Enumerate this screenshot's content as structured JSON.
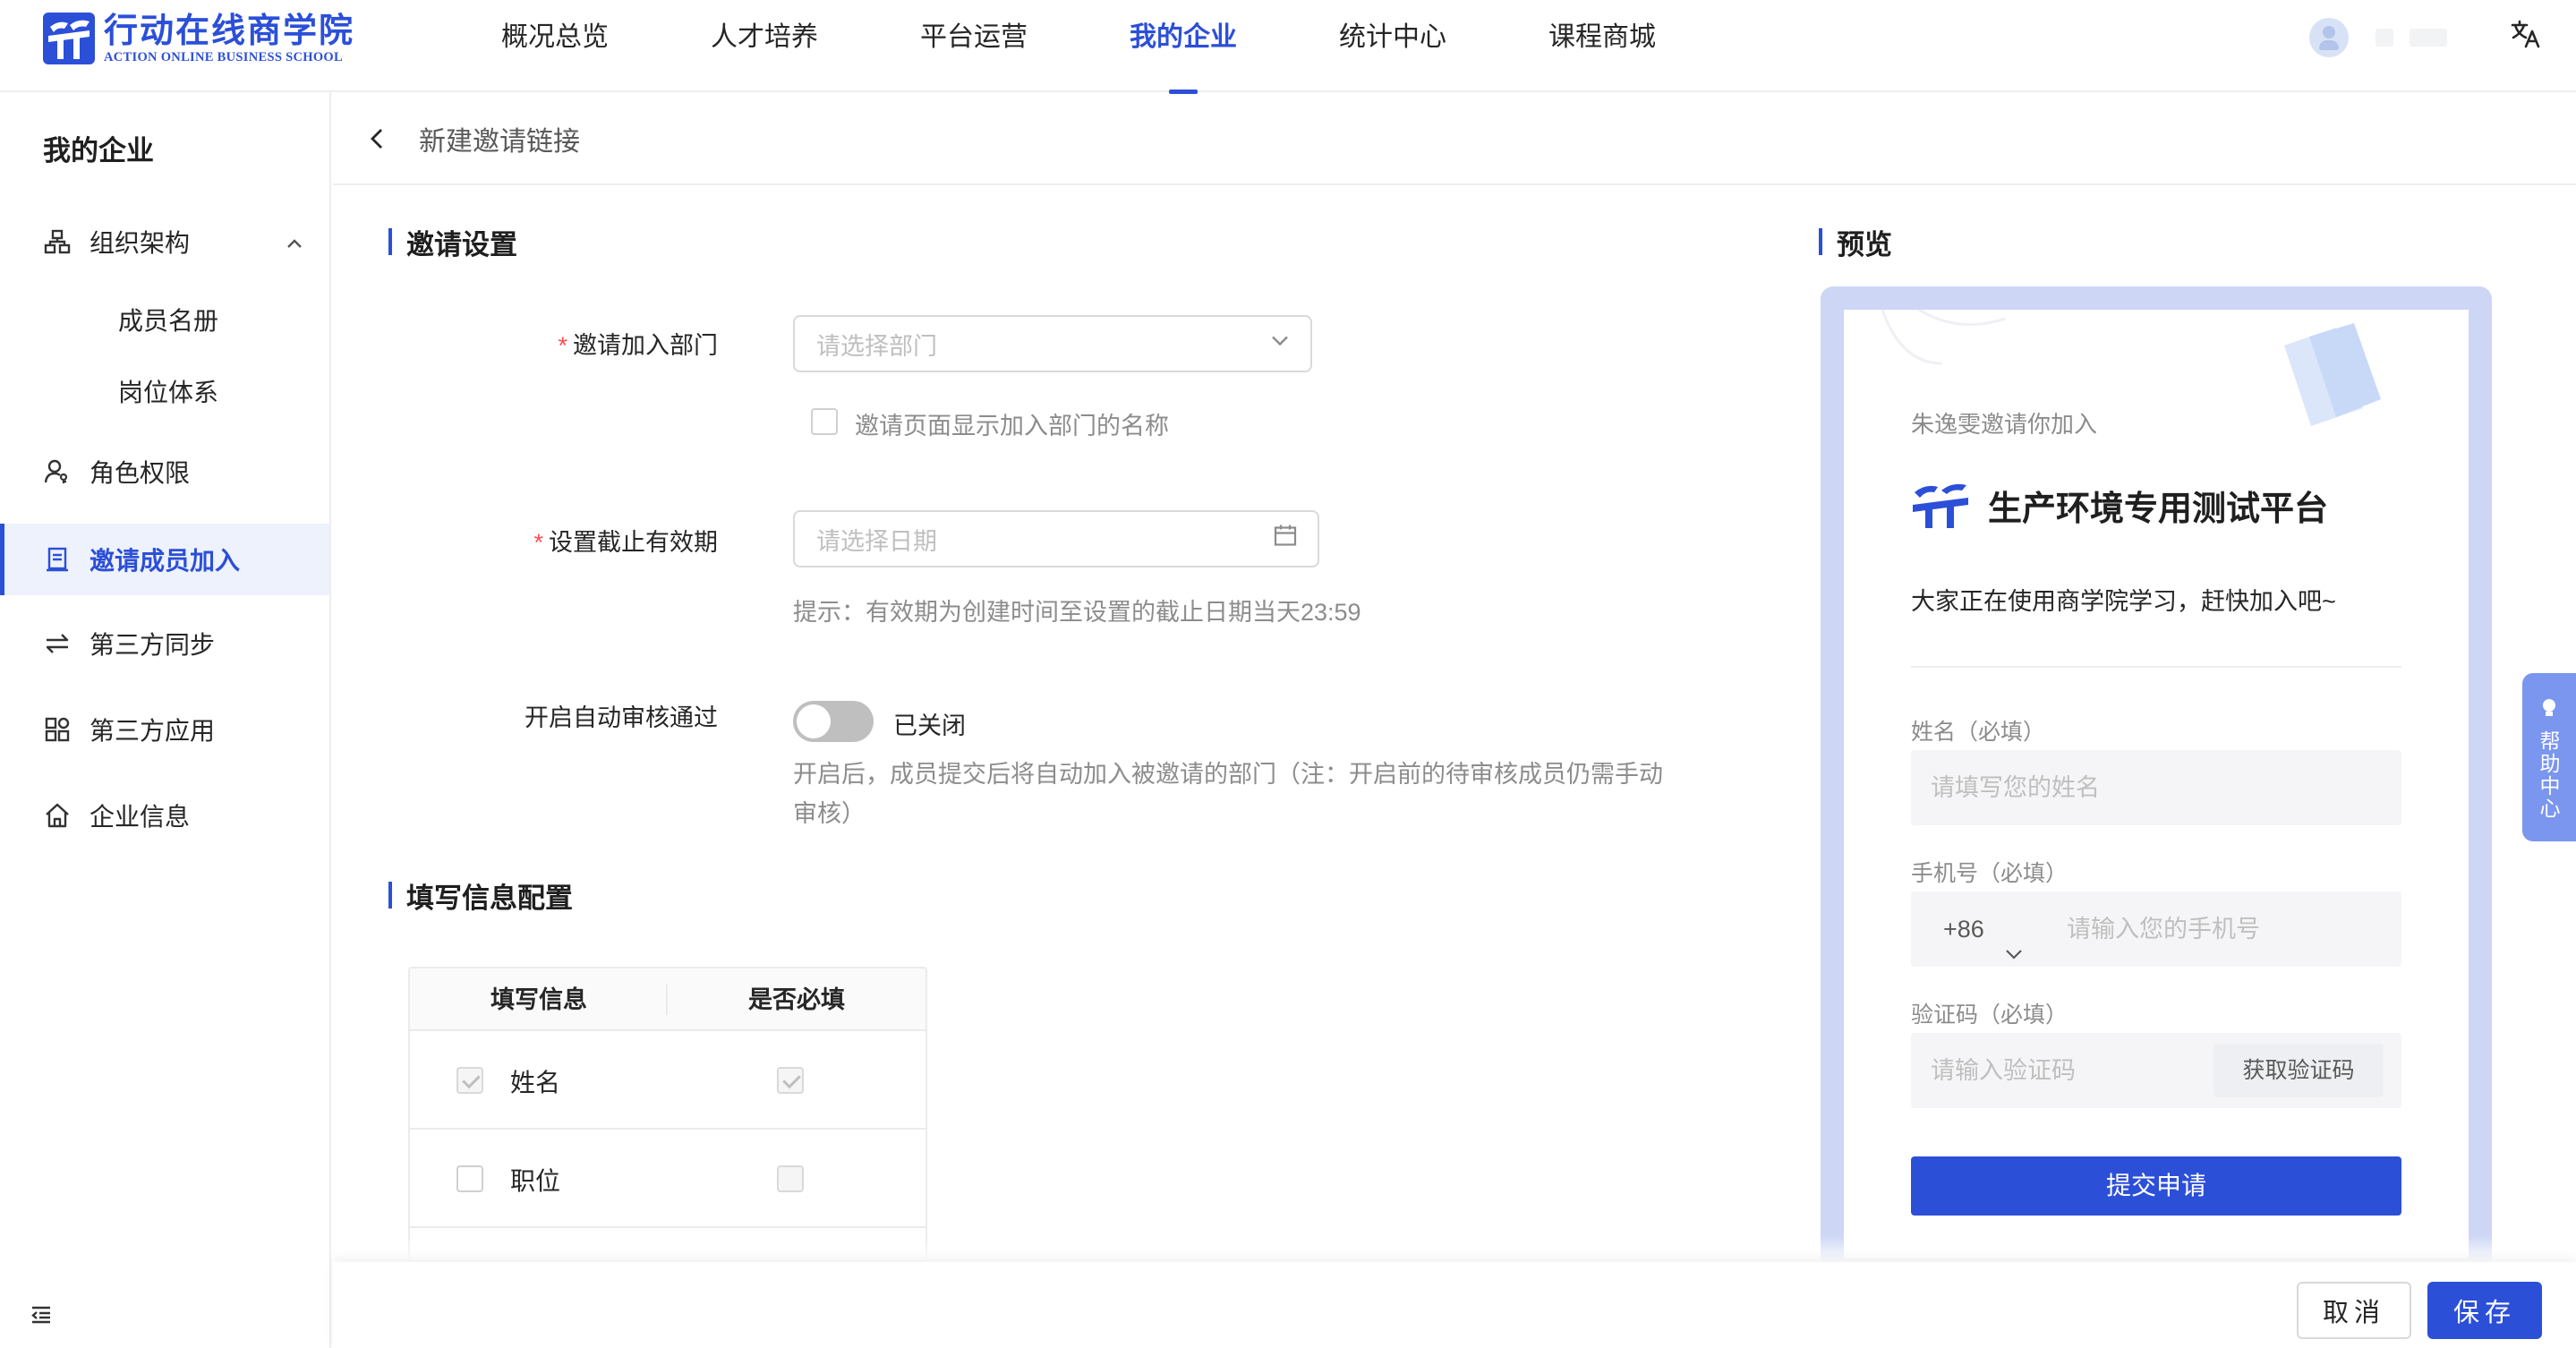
{
  "brand": {
    "name_cn": "行动在线商学院",
    "name_en": "ACTION ONLINE BUSINESS SCHOOL",
    "color": "#2c4fd8"
  },
  "nav": {
    "items": [
      {
        "label": "概况总览",
        "active": false
      },
      {
        "label": "人才培养",
        "active": false
      },
      {
        "label": "平台运营",
        "active": false
      },
      {
        "label": "我的企业",
        "active": true
      },
      {
        "label": "统计中心",
        "active": false
      },
      {
        "label": "课程商城",
        "active": false
      }
    ],
    "lang_icon": "translate-icon",
    "lang_label": "文A"
  },
  "sidebar": {
    "title": "我的企业",
    "items": [
      {
        "label": "组织架构",
        "icon": "org-chart-icon",
        "expanded": true
      },
      {
        "label": "成员名册",
        "sub": true
      },
      {
        "label": "岗位体系",
        "sub": true
      },
      {
        "label": "角色权限",
        "icon": "user-key-icon"
      },
      {
        "label": "邀请成员加入",
        "icon": "invite-doc-icon",
        "active": true
      },
      {
        "label": "第三方同步",
        "icon": "sync-icon"
      },
      {
        "label": "第三方应用",
        "icon": "apps-icon"
      },
      {
        "label": "企业信息",
        "icon": "home-icon"
      }
    ]
  },
  "page": {
    "title": "新建邀请链接"
  },
  "invite_settings": {
    "section_title": "邀请设置",
    "department": {
      "label": "邀请加入部门",
      "required": true,
      "placeholder": "请选择部门",
      "show_name_checkbox_label": "邀请页面显示加入部门的名称"
    },
    "expiry": {
      "label": "设置截止有效期",
      "required": true,
      "placeholder": "请选择日期",
      "hint": "提示：有效期为创建时间至设置的截止日期当天23:59"
    },
    "auto_approve": {
      "label": "开启自动审核通过",
      "state_label": "已关闭",
      "enabled": false,
      "note_line1": "开启后，成员提交后将自动加入被邀请的部门（注：开启前的待审核成员仍需手动",
      "note_line2": "审核）"
    }
  },
  "fill_config": {
    "section_title": "填写信息配置",
    "columns": [
      "填写信息",
      "是否必填"
    ],
    "rows": [
      {
        "field": "姓名",
        "enabled": true,
        "required": true
      },
      {
        "field": "职位",
        "enabled": false,
        "required": false
      }
    ]
  },
  "preview": {
    "section_title": "预览",
    "inviter_text": "朱逸雯邀请你加入",
    "platform_name": "生产环境专用测试平台",
    "description": "大家正在使用商学院学习，赶快加入吧~",
    "name_label": "姓名（必填）",
    "name_placeholder": "请填写您的姓名",
    "phone_label": "手机号（必填）",
    "phone_code": "+86",
    "phone_placeholder": "请输入您的手机号",
    "code_label": "验证码（必填）",
    "code_placeholder": "请输入验证码",
    "get_code_label": "获取验证码",
    "submit_label": "提交申请"
  },
  "help": {
    "label": "帮助中心"
  },
  "actions": {
    "cancel_label": "取消",
    "save_label": "保存"
  }
}
